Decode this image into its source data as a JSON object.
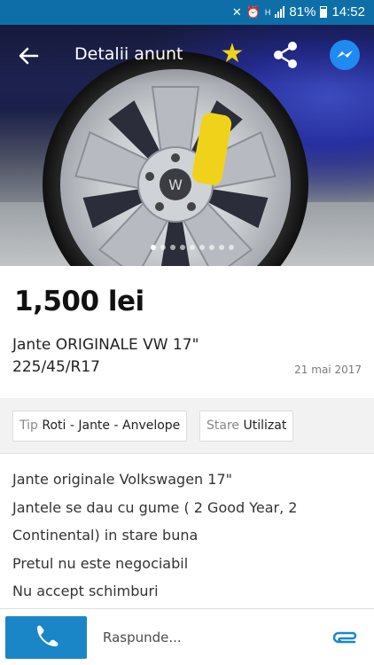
{
  "status_bar": {
    "battery": "81%",
    "time": "14:52",
    "network": "H"
  },
  "header": {
    "title": "Detalii anunt"
  },
  "gallery": {
    "dots": 9,
    "active_index": 0
  },
  "ad": {
    "price": "1,500 lei",
    "title_line1": "Jante ORIGINALE VW 17\"",
    "title_line2": "225/45/R17",
    "date": "21 mai 2017"
  },
  "attributes": [
    {
      "key": "Tip",
      "value": "Roti - Jante - Anvelope"
    },
    {
      "key": "Stare",
      "value": "Utilizat"
    }
  ],
  "description": [
    "Jante originale Volkswagen 17\"",
    "Jantele se dau cu gume ( 2 Good Year, 2",
    "Continental) in stare buna",
    "Pretul nu este negociabil",
    "Nu accept schimburi"
  ],
  "reply": {
    "placeholder": "Raspunde..."
  },
  "colors": {
    "accent": "#1a86c8",
    "status_bar": "#0e6fa8",
    "star": "#f2d218"
  }
}
